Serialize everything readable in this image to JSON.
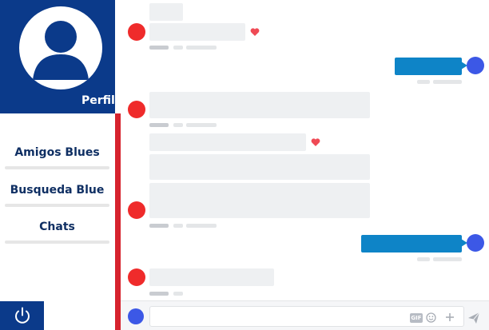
{
  "sidebar": {
    "profile_label": "Perfil",
    "items": [
      {
        "label": "Amigos Blues"
      },
      {
        "label": "Busqueda Blue"
      },
      {
        "label": "Chats"
      }
    ],
    "power_icon": "power-icon"
  },
  "composer": {
    "gif_label": "GIF",
    "placeholder": "",
    "icons": [
      "emoji-icon",
      "plus-icon",
      "send-icon"
    ]
  },
  "colors": {
    "brand_dark": "#0b3a8a",
    "accent_red": "#d6232e",
    "outgoing_bubble": "#0e84c7",
    "incoming_bubble": "#eef0f2",
    "contact_dot": "#ef2b2b",
    "self_dot": "#3c58e6",
    "heart": "#ef4a55"
  }
}
